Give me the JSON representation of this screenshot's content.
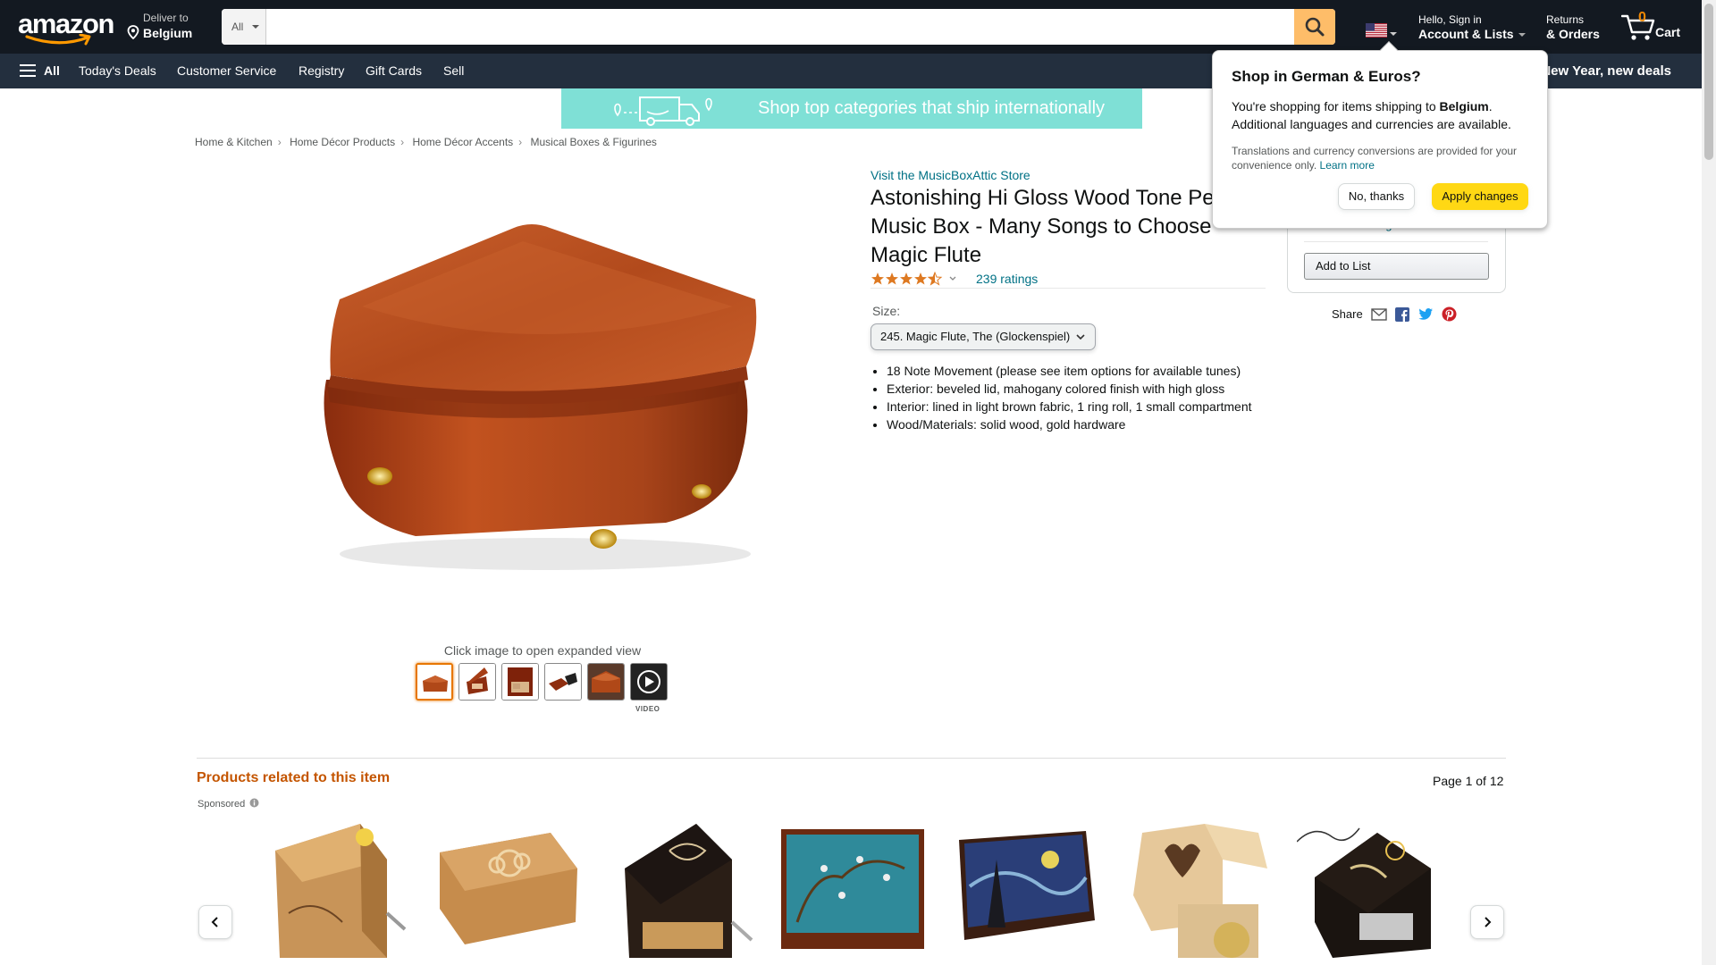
{
  "header": {
    "logo_text": "amazon",
    "deliver_line1": "Deliver to",
    "deliver_line2": "Belgium",
    "search_category": "All",
    "search_placeholder": "",
    "account_line1": "Hello, Sign in",
    "account_line2": "Account & Lists",
    "returns_line1": "Returns",
    "returns_line2": "& Orders",
    "cart_count": "0",
    "cart_label": "Cart"
  },
  "nav": {
    "all": "All",
    "items": [
      "Today's Deals",
      "Customer Service",
      "Registry",
      "Gift Cards",
      "Sell"
    ],
    "promo": "New Year, new deals"
  },
  "banner": {
    "text": "Shop top categories that ship internationally"
  },
  "breadcrumb": [
    "Home & Kitchen",
    "Home Décor Products",
    "Home Décor Accents",
    "Musical Boxes & Figurines"
  ],
  "gallery": {
    "hint": "Click image to open expanded view",
    "video_label": "VIDEO"
  },
  "product": {
    "store": "Visit the MusicBoxAttic Store",
    "title": "Astonishing Hi Gloss Wood Tone Pe... Music Box - Many Songs to Choose - Magic Flute",
    "title_line1": "Astonishing Hi Gloss Wood Tone Pe",
    "title_line2": "Music Box - Many Songs to Choose -",
    "title_line3": "Magic Flute",
    "rating_stars": 4.5,
    "ratings_count": "239 ratings",
    "size_label": "Size:",
    "size_value": "245. Magic Flute, The (Glockenspiel)",
    "bullets": [
      "18 Note Movement (please see item options for available tunes)",
      "Exterior: beveled lid, mahogany colored finish with high gloss",
      "Interior: lined in light brown fabric, 1 ring roll, 1 small compartment",
      "Wood/Materials: solid wood, gold hardware"
    ]
  },
  "buybox": {
    "deliver_link": "Deliver to Belgium",
    "add_to_list": "Add to List",
    "share": "Share"
  },
  "popover": {
    "title": "Shop in German & Euros?",
    "body_pre": "You're shopping for items shipping to ",
    "body_country": "Belgium",
    "body_post": ". Additional languages and currencies are available.",
    "note": "Translations and currency conversions are provided for your convenience only.",
    "learn_more": "Learn more",
    "no_thanks": "No, thanks",
    "apply": "Apply changes"
  },
  "related": {
    "title": "Products related to this item",
    "sponsored": "Sponsored",
    "page_info": "Page 1 of 12"
  },
  "colors": {
    "header_bg": "#131921",
    "nav_bg": "#232f3e",
    "search_btn": "#febd69",
    "link": "#007185",
    "related_title": "#c45500",
    "apply_btn": "#ffd814",
    "star": "#de7921"
  }
}
